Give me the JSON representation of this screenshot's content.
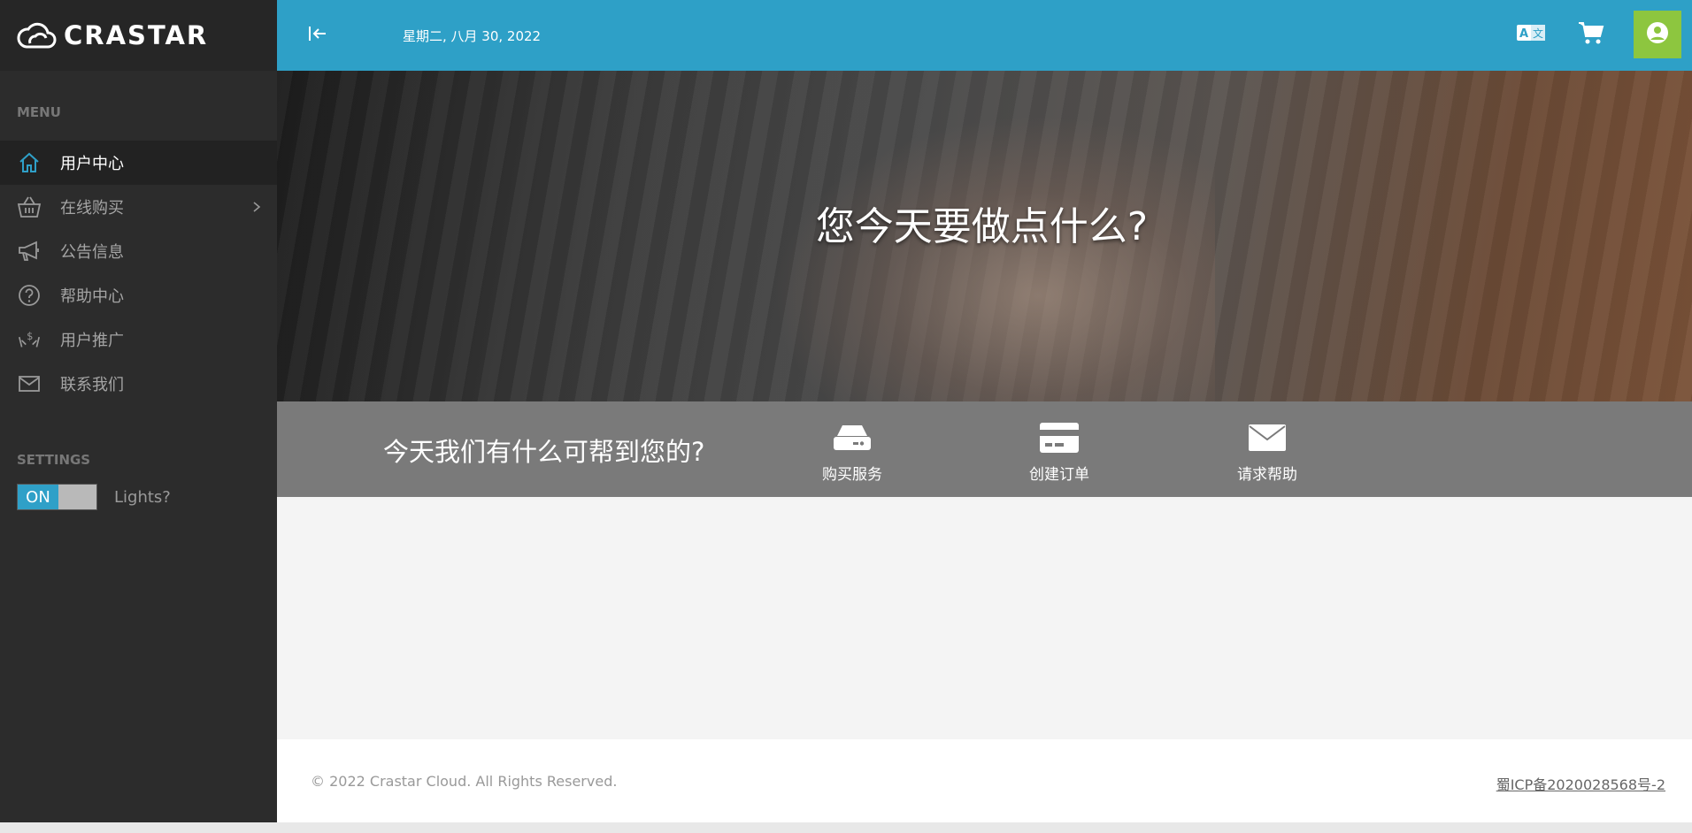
{
  "brand": {
    "name": "CRASTAR"
  },
  "sidebar": {
    "menu_title": "MENU",
    "items": [
      {
        "label": "用户中心",
        "icon": "home-icon"
      },
      {
        "label": "在线购买",
        "icon": "basket-icon"
      },
      {
        "label": "公告信息",
        "icon": "megaphone-icon"
      },
      {
        "label": "帮助中心",
        "icon": "help-circle-icon"
      },
      {
        "label": "用户推广",
        "icon": "hands-dollar-icon"
      },
      {
        "label": "联系我们",
        "icon": "envelope-icon"
      }
    ],
    "settings_title": "SETTINGS",
    "toggle_state": "ON",
    "lights_label": "Lights?"
  },
  "topbar": {
    "date": "星期二, 八月 30, 2022"
  },
  "hero": {
    "title": "您今天要做点什么?"
  },
  "help": {
    "text": "今天我们有什么可帮到您的?",
    "actions": [
      {
        "label": "购买服务",
        "icon": "server-icon"
      },
      {
        "label": "创建订单",
        "icon": "credit-card-icon"
      },
      {
        "label": "请求帮助",
        "icon": "envelope-icon"
      }
    ]
  },
  "footer": {
    "copyright": "© 2022 Crastar Cloud. All Rights Reserved.",
    "icp": "蜀ICP备2020028568号-2"
  },
  "colors": {
    "topbar": "#2ea0c7",
    "sidebar": "#2c2c2c",
    "user_button": "#8dc63f",
    "help_strip": "#7a7a7a"
  }
}
